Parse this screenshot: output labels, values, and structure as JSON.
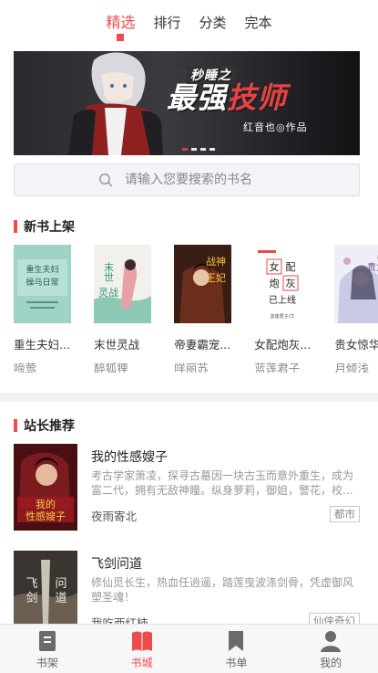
{
  "top_tabs": [
    {
      "label": "精选",
      "active": true
    },
    {
      "label": "排行",
      "active": false
    },
    {
      "label": "分类",
      "active": false
    },
    {
      "label": "完本",
      "active": false
    }
  ],
  "banner": {
    "pre_title": "秒睡之",
    "title_main": "最强",
    "title_accent": "技师",
    "subtitle": "红音也◎作品",
    "slide_count": 4,
    "active_slide": 0
  },
  "search": {
    "placeholder": "请输入您要搜索的书名"
  },
  "new_books": {
    "section_title": "新书上架",
    "items": [
      {
        "title": "重生夫妇...",
        "author": "啼莺",
        "cover_text": "重生夫妇操马日常"
      },
      {
        "title": "末世灵战",
        "author": "醉狐狸",
        "cover_text": "末世灵战"
      },
      {
        "title": "帝妻霸宠...",
        "author": "咩丽苏",
        "cover_text": "战神王妃"
      },
      {
        "title": "女配炮灰...",
        "author": "蓝莲君子",
        "cover_text": "女配炮灰已上线"
      },
      {
        "title": "贵女惊华",
        "author": "月倾浅",
        "cover_text": "贵女惊华"
      }
    ]
  },
  "recommend": {
    "section_title": "站长推荐",
    "items": [
      {
        "title": "我的性感嫂子",
        "desc": "考古学家萧凌，探寻古墓因一块古玉而意外重生，成为富二代，拥有无敌神瞳。纵身萝莉，御姐，警花，校...",
        "author": "夜雨寄北",
        "tag": "都市",
        "cover_text": "我的性感嫂子"
      },
      {
        "title": "飞剑问道",
        "desc": "修仙觅长生，热血任逍遥，踏莲曳波涤剑骨，凭虚御风塑圣魂！",
        "author": "我吃西红柿",
        "tag": "仙侠奇幻",
        "cover_text": "飞剑问道"
      }
    ]
  },
  "bottom_nav": [
    {
      "label": "书架",
      "icon": "bookshelf-icon",
      "active": false
    },
    {
      "label": "书城",
      "icon": "bookstore-icon",
      "active": true
    },
    {
      "label": "书单",
      "icon": "booklist-icon",
      "active": false
    },
    {
      "label": "我的",
      "icon": "profile-icon",
      "active": false
    }
  ],
  "colors": {
    "accent": "#ee4b4b",
    "text": "#333333",
    "muted": "#999999",
    "nav_bg": "#f7f7f7"
  }
}
